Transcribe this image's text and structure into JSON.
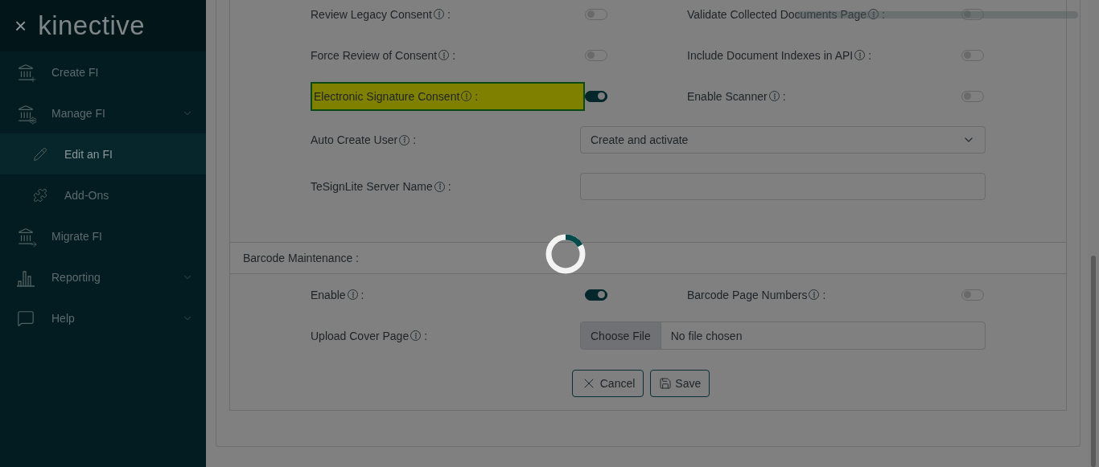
{
  "sidebar": {
    "close": "×",
    "logo": "kinective",
    "items": [
      {
        "label": "Create FI",
        "kind": "create",
        "expandable": false,
        "selected": false
      },
      {
        "label": "Manage FI",
        "kind": "manage",
        "expandable": true,
        "selected": false,
        "children": [
          {
            "label": "Edit an FI",
            "kind": "edit",
            "selected": true
          },
          {
            "label": "Add-Ons",
            "kind": "addons",
            "selected": false
          }
        ]
      },
      {
        "label": "Migrate FI",
        "kind": "migrate",
        "expandable": false,
        "selected": false
      },
      {
        "label": "Reporting",
        "kind": "reporting",
        "expandable": true,
        "selected": false
      },
      {
        "label": "Help",
        "kind": "help",
        "expandable": true,
        "selected": false
      }
    ]
  },
  "settings": {
    "rows": [
      {
        "kind": "toggles",
        "left": {
          "label": "Review Legacy Consent",
          "colon": ":",
          "on": false,
          "highlighted": false
        },
        "right": {
          "label": "Validate Collected Documents Page",
          "colon": ":",
          "on": false
        }
      },
      {
        "kind": "toggles",
        "left": {
          "label": "Force Review of Consent",
          "colon": ":",
          "on": false,
          "highlighted": false
        },
        "right": {
          "label": "Include Document Indexes in API",
          "colon": ":",
          "on": false
        }
      },
      {
        "kind": "toggles",
        "left": {
          "label": "Electronic Signature Consent",
          "colon": ":",
          "on": true,
          "highlighted": true
        },
        "right": {
          "label": "Enable Scanner",
          "colon": ":",
          "on": false
        }
      },
      {
        "kind": "select",
        "label": "Auto Create User",
        "colon": ":",
        "value": "Create and activate"
      },
      {
        "kind": "text",
        "label": "TeSignLite Server Name",
        "colon": ":"
      }
    ]
  },
  "barcode": {
    "title": "Barcode Maintenance :",
    "rows": [
      {
        "kind": "toggles",
        "left": {
          "label": "Enable",
          "colon": ":",
          "on": true,
          "highlighted": false
        },
        "right": {
          "label": "Barcode Page Numbers",
          "colon": ":",
          "on": false
        }
      },
      {
        "kind": "file",
        "label": "Upload Cover Page",
        "colon": ":",
        "button": "Choose File",
        "value": "No file chosen"
      }
    ]
  },
  "buttons": [
    {
      "kind": "cancel",
      "label": "Cancel"
    },
    {
      "kind": "save",
      "label": "Save"
    }
  ],
  "loading": true
}
